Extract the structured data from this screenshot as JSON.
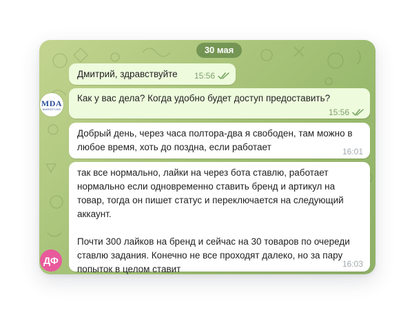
{
  "date_label": "30 мая",
  "messages": [
    {
      "text": "Дмитрий, здравствуйте",
      "time": "15:56"
    },
    {
      "text": "Как у вас дела? Когда удобно будет доступ предоставить?",
      "time": "15:56"
    },
    {
      "text": "Добрый день, через часа полтора-два я свободен, там можно в любое время, хоть до поздна, если работает",
      "time": "16:01"
    },
    {
      "text": "так все нормально, лайки на через бота ставлю, работает нормально если одновременно ставить бренд и артикул на товар, тогда он пишет статус и переключается на следующий аккаунт.\n\nПочти 300 лайков на бренд и сейчас на 30 товаров по очереди ставлю задания. Конечно не все проходят далеко, но за пару попыток в целом ставит",
      "time": "16:03"
    }
  ],
  "avatars": {
    "outgoing_logo_text": "MDA",
    "outgoing_logo_subtext": "MARKETING",
    "incoming_initials": "ДФ"
  },
  "colors": {
    "outgoing_bubble": "#eefbdd",
    "incoming_bubble": "#ffffff",
    "read_check": "#6fa05a",
    "avatar_df": "#e85a9c",
    "chat_background": "#a9c47a"
  },
  "icons": {
    "read_receipt": "double-check-icon"
  }
}
